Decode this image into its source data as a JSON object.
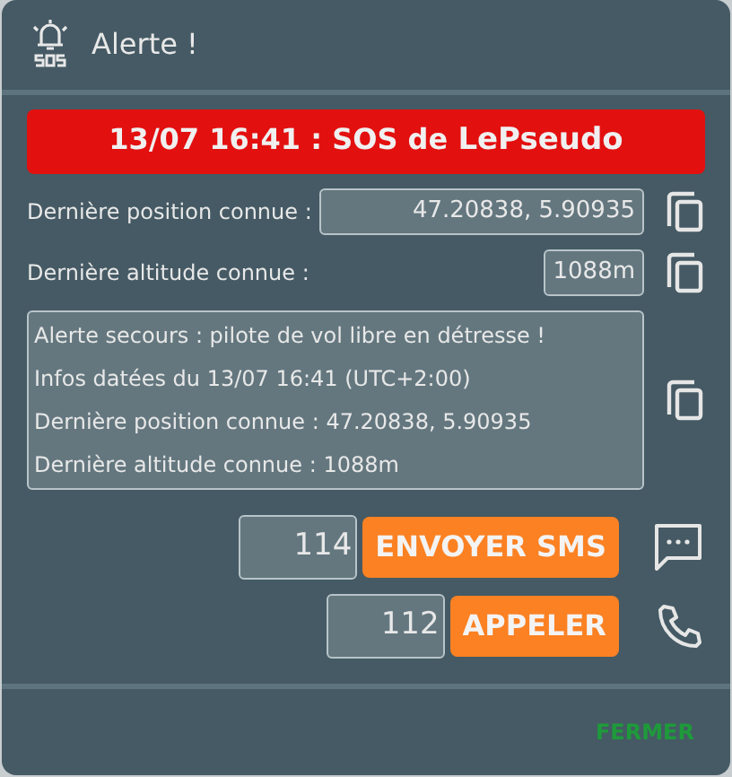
{
  "dialog": {
    "title": "Alerte !"
  },
  "banner": {
    "text": "13/07 16:41 : SOS de ",
    "name": "LePseudo"
  },
  "fields": [
    {
      "label": "Dernière position connue :",
      "value": "47.20838, 5.90935",
      "wide": true
    },
    {
      "label": "Dernière altitude connue :",
      "value": "1088m",
      "wide": false
    }
  ],
  "message": [
    "Alerte secours : pilote de vol libre en détresse !",
    "Infos datées du 13/07 16:41 (UTC+2:00)",
    "Dernière position connue : 47.20838, 5.90935",
    "Dernière altitude connue : 1088m"
  ],
  "actions": [
    {
      "kind": "sms",
      "number": "114",
      "button": "ENVOYER SMS"
    },
    {
      "kind": "call",
      "number": "112",
      "button": "APPELER"
    }
  ],
  "footer": {
    "button": "FERMER"
  }
}
